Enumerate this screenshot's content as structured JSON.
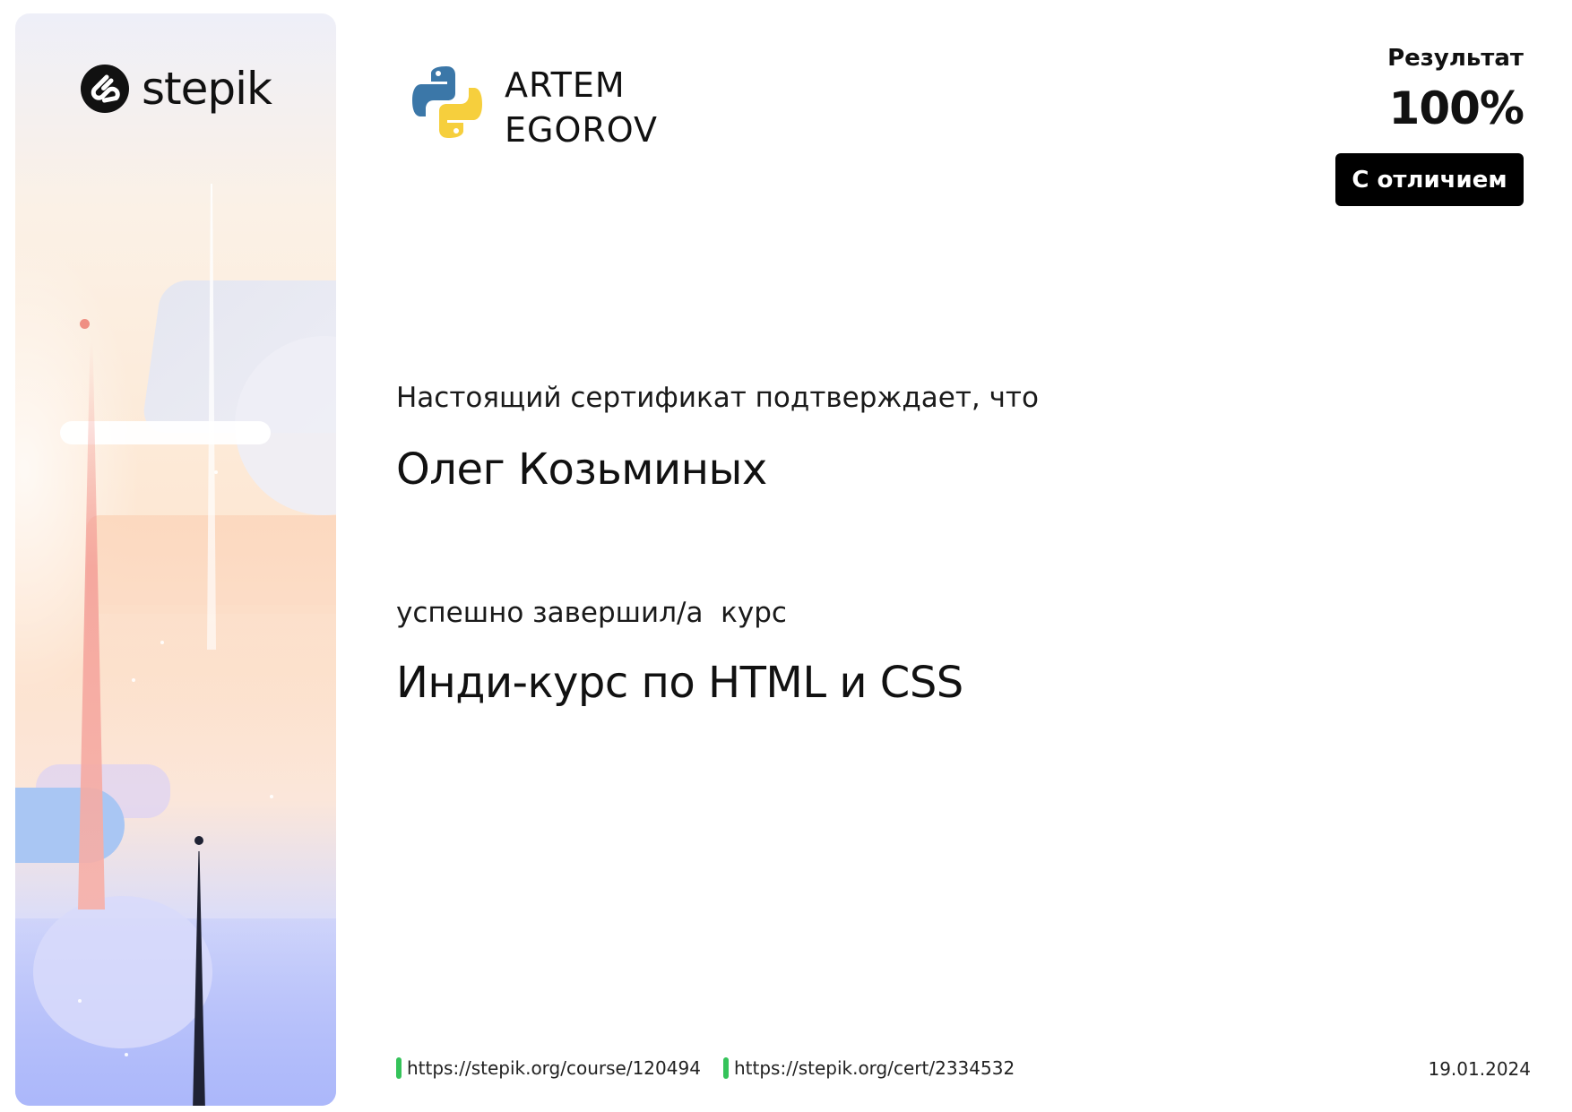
{
  "brand": {
    "name": "stepik",
    "mark_icon": "stepik-s-mark",
    "colors": {
      "dark": "#111111",
      "link_marker": "#35c35a"
    }
  },
  "author": {
    "logo_icon": "python-logo",
    "line1": "ARTEM",
    "line2": "EGOROV"
  },
  "result": {
    "label": "Результат",
    "value": "100%",
    "badge": "С отличием"
  },
  "certificate": {
    "confirm_text": "Настоящий сертификат подтверждает, что",
    "recipient": "Олег Козьминых",
    "completed_text": "успешно завершил/а  курс",
    "course": "Инди-курс по HTML и CSS"
  },
  "footer": {
    "course_url": "https://stepik.org/course/120494",
    "cert_url": "https://stepik.org/cert/2334532",
    "date": "19.01.2024"
  }
}
